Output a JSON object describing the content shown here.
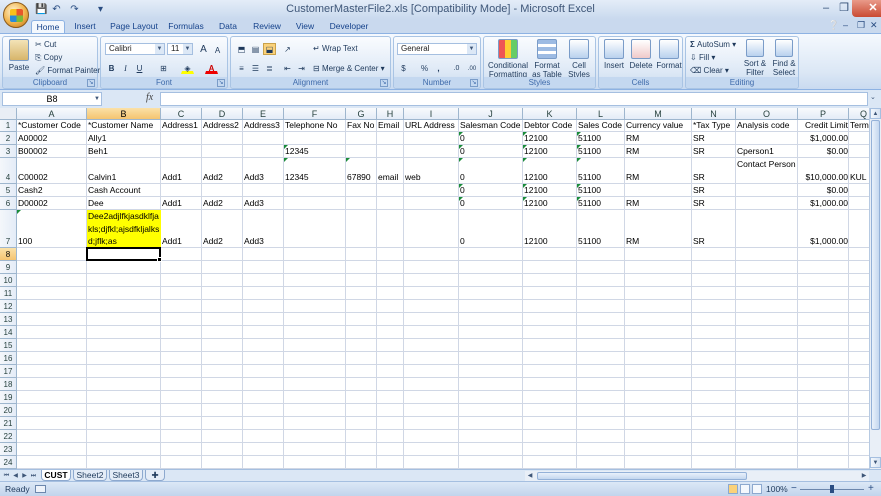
{
  "window": {
    "title": "CustomerMasterFile2.xls  [Compatibility Mode] - Microsoft Excel",
    "minimize": "–",
    "restore": "❐",
    "close": "✕"
  },
  "quick_access": [
    "save-icon",
    "undo-icon",
    "redo-icon",
    "customize-icon"
  ],
  "tabs": [
    "Home",
    "Insert",
    "Page Layout",
    "Formulas",
    "Data",
    "Review",
    "View",
    "Developer"
  ],
  "active_tab": "Home",
  "ribbon": {
    "clipboard": {
      "label": "Clipboard",
      "paste": "Paste",
      "cut": "Cut",
      "copy": "Copy",
      "format_painter": "Format Painter"
    },
    "font": {
      "label": "Font",
      "name": "Calibri",
      "size": "11",
      "bold": "B",
      "italic": "I",
      "underline": "U",
      "grow": "A",
      "shrink": "A"
    },
    "alignment": {
      "label": "Alignment",
      "wrap_text": "Wrap Text",
      "merge_center": "Merge & Center"
    },
    "number": {
      "label": "Number",
      "format": "General",
      "currency": "$",
      "percent": "%",
      "comma": ",",
      "inc_decimal": ".0",
      "dec_decimal": ".00"
    },
    "styles": {
      "label": "Styles",
      "conditional_formatting": "Conditional Formatting",
      "format_as_table": "Format as Table",
      "cell_styles": "Cell Styles"
    },
    "cells": {
      "label": "Cells",
      "insert": "Insert",
      "delete": "Delete",
      "format": "Format"
    },
    "editing": {
      "label": "Editing",
      "autosum": "AutoSum",
      "fill": "Fill",
      "clear": "Clear",
      "sort_filter": "Sort & Filter",
      "find_select": "Find & Select"
    }
  },
  "formula_bar": {
    "name_box": "B8",
    "fx": "fx",
    "formula": ""
  },
  "columns": [
    "A",
    "B",
    "C",
    "D",
    "E",
    "F",
    "G",
    "H",
    "I",
    "J",
    "K",
    "L",
    "M",
    "N",
    "O",
    "P",
    "Q"
  ],
  "selected_column": "B",
  "selected_row": 8,
  "rows": [
    "1",
    "2",
    "3",
    "4",
    "5",
    "6",
    "7",
    "8",
    "9",
    "10",
    "11",
    "12",
    "13",
    "14",
    "15",
    "16",
    "17",
    "18",
    "19",
    "20",
    "21",
    "22",
    "23",
    "24"
  ],
  "cells": {
    "A1": "*Customer Code",
    "B1": "*Customer Name",
    "C1": "Address1",
    "D1": "Address2",
    "E1": "Address3",
    "F1": "Telephone No",
    "G1": "Fax No",
    "H1": "Email",
    "I1": "URL Address",
    "J1": "Salesman Code",
    "K1": "Debtor Code",
    "L1": "Sales Code",
    "M1": "Currency value",
    "N1": "*Tax Type",
    "O1": "Analysis code",
    "P1": "Credit Limit",
    "Q1": "Terms",
    "A2": "A00002",
    "B2": "Ally1",
    "J2": "0",
    "K2": "12100",
    "L2": "51100",
    "M2": "RM",
    "N2": "SR",
    "P2": "$1,000.00",
    "A3": "B00002",
    "B3": "Beh1",
    "F3": "12345",
    "J3": "0",
    "K3": "12100",
    "L3": "51100",
    "M3": "RM",
    "N3": "SR",
    "O3": "Cperson1",
    "P3": "$0.00",
    "A4": "C00002",
    "B4": "Calvin1",
    "C4": "Add1",
    "D4": "Add2",
    "E4": "Add3",
    "F4": "12345",
    "G4": "67890",
    "H4": "email",
    "I4": "web",
    "J4": "0",
    "K4": "12100",
    "L4": "51100",
    "M4": "RM",
    "N4": "SR",
    "O4": "Contact Person",
    "P4": "$10,000.00",
    "Q4": "KUL",
    "A5": "Cash2",
    "B5": "Cash Account",
    "J5": "0",
    "K5": "12100",
    "L5": "51100",
    "N5": "SR",
    "P5": "$0.00",
    "A6": "D00002",
    "B6": "Dee",
    "C6": "Add1",
    "D6": "Add2",
    "E6": "Add3",
    "J6": "0",
    "K6": "12100",
    "L6": "51100",
    "M6": "RM",
    "N6": "SR",
    "P6": "$1,000.00",
    "A7": "100",
    "B7": "Dee2adjlfkjasdklfjakls;djfkl;ajsdfkljalksd;jflk;as",
    "C7": "Add1",
    "D7": "Add2",
    "E7": "Add3",
    "J7": "0",
    "K7": "12100",
    "L7": "51100",
    "M7": "RM",
    "N7": "SR",
    "P7": "$1,000.00"
  },
  "sheets": [
    "CUST",
    "Sheet2",
    "Sheet3"
  ],
  "active_sheet": "CUST",
  "status": {
    "text": "Ready",
    "zoom": "100%",
    "zoom_out": "−",
    "zoom_in": "+"
  },
  "colors": {
    "highlight": "#ffff00",
    "selection_header": "#f5c471",
    "error_triangle": "#1a8c3a"
  }
}
